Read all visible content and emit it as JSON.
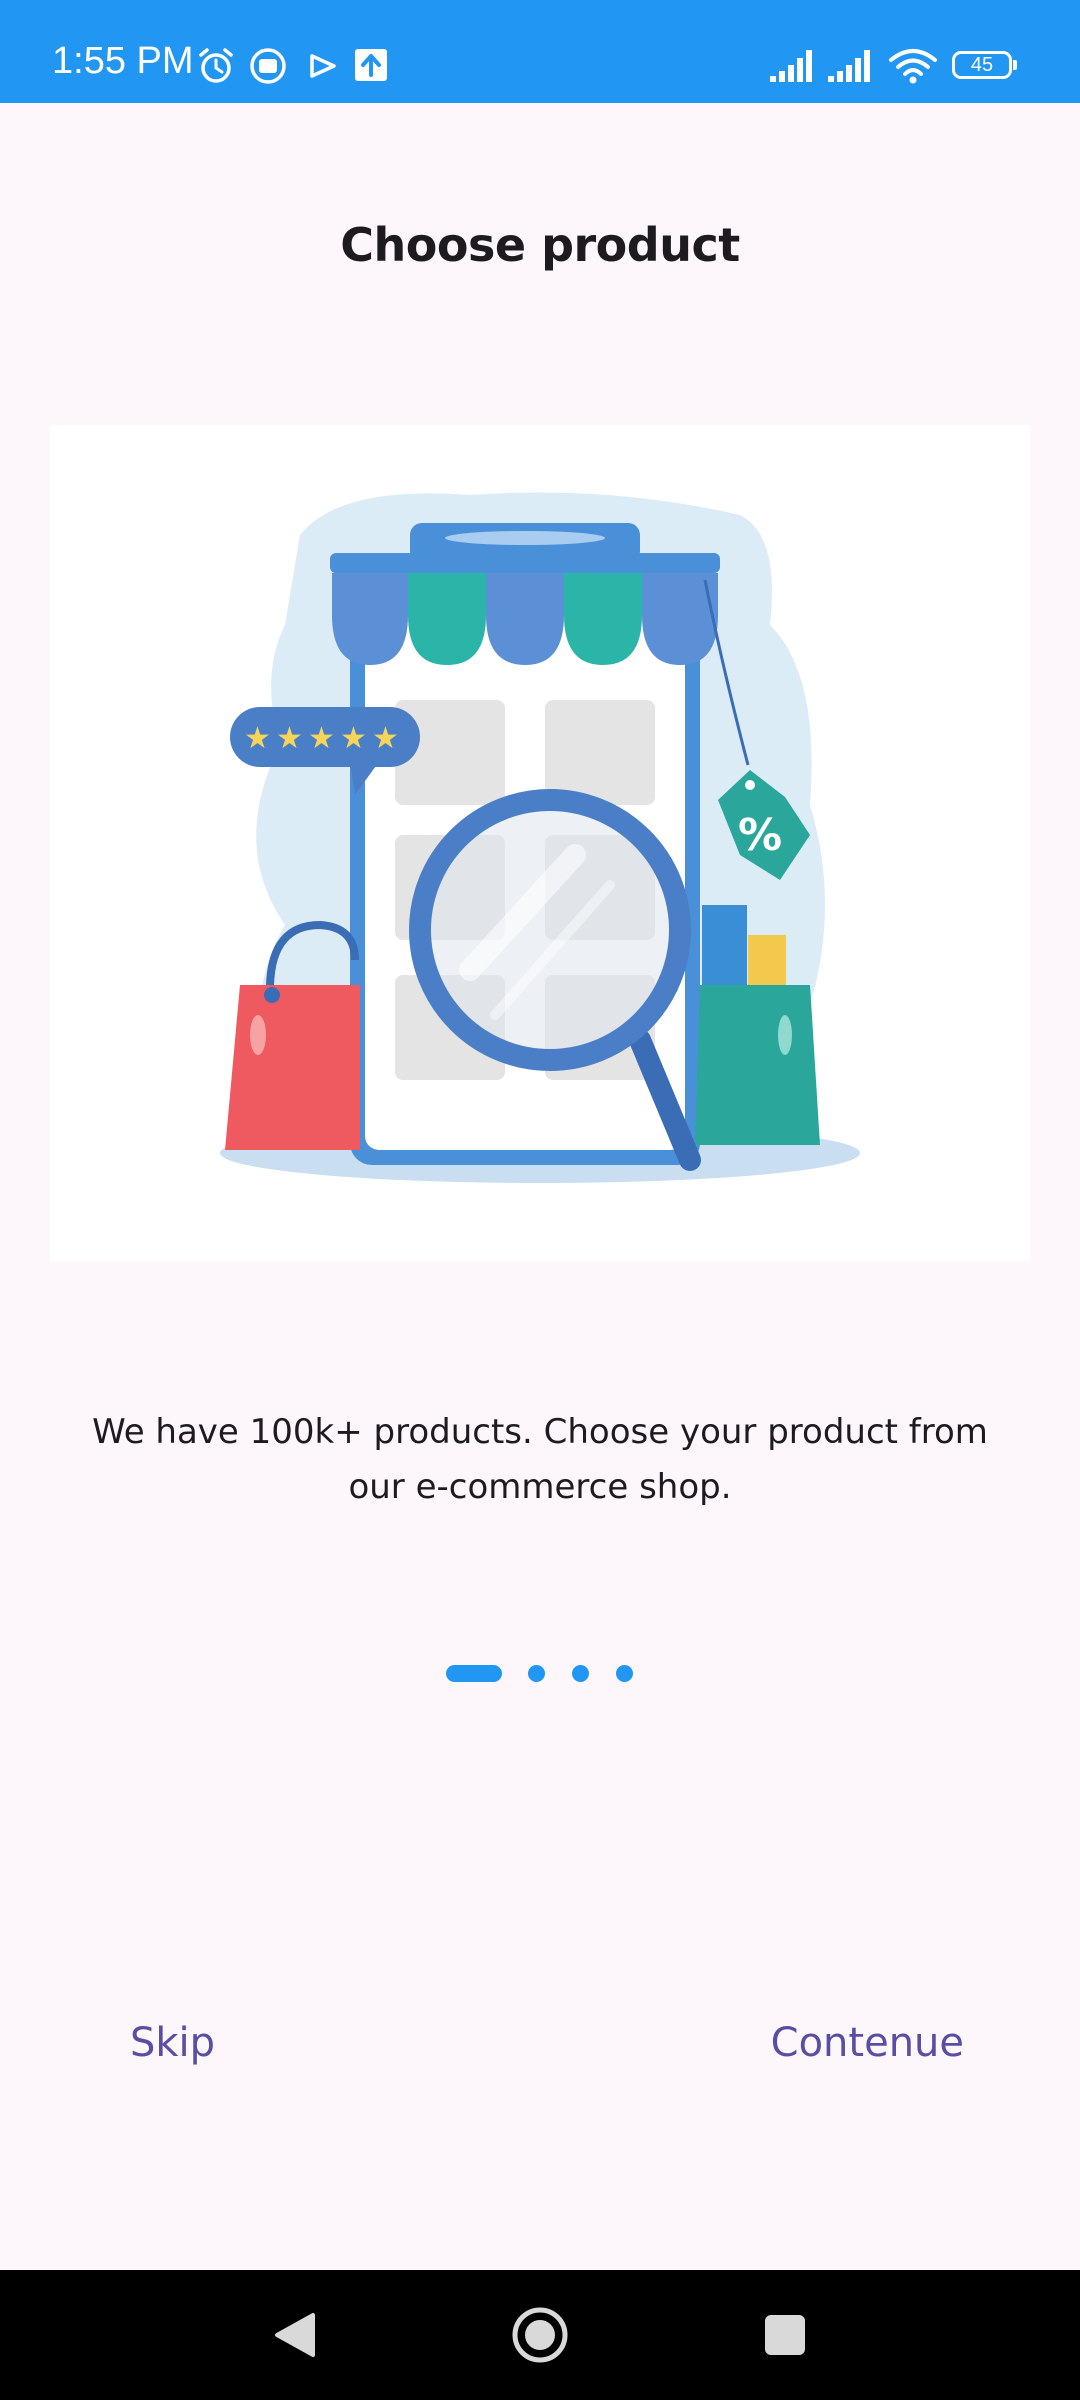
{
  "status_bar": {
    "time": "1:55 PM",
    "battery_level": "45",
    "icons": [
      "alarm-icon",
      "notification-icon",
      "play-store-icon",
      "upload-icon",
      "signal-icon",
      "signal-icon",
      "wifi-icon",
      "battery-icon"
    ],
    "color": "#2196f3"
  },
  "onboarding": {
    "title": "Choose product",
    "description": "We have 100k+ products. Choose your product from our e-commerce shop.",
    "illustration": "shopping-search-illustration",
    "page_indicator": {
      "total": 4,
      "current": 1
    }
  },
  "actions": {
    "skip_label": "Skip",
    "next_label": "Contenue"
  },
  "navigation_bar": {
    "icons": [
      "back-icon",
      "home-icon",
      "recents-icon"
    ]
  },
  "colors": {
    "accent": "#2196f3",
    "button_text": "#5a4ea3",
    "background": "#fdf7fc"
  }
}
